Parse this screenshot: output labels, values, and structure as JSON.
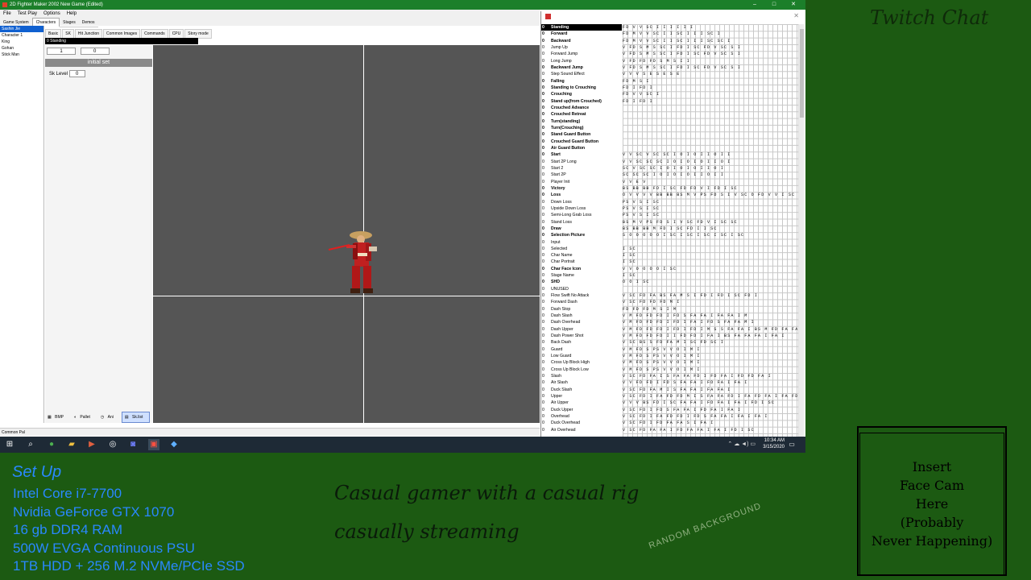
{
  "window": {
    "title": "2D Fighter Maker 2002 New Game (Edited)",
    "controls": [
      "–",
      "□",
      "✕"
    ]
  },
  "menu": [
    "File",
    "Test Play",
    "Options",
    "Help"
  ],
  "main_tabs": [
    "Game System",
    "Characters",
    "Stages",
    "Demos"
  ],
  "characters": [
    "Sashin Jie",
    "Character 1",
    "King",
    "Gohan",
    "Stick Man"
  ],
  "sub_tabs": [
    "Basic",
    "SK",
    "Hit Junction",
    "Common Images",
    "Commands",
    "CPU",
    "Story mode"
  ],
  "current_state_label": "0  Standing",
  "props": {
    "field1": "1",
    "field2": "0",
    "initial_set": "initial set",
    "sk_level_label": "Sk Level",
    "sk_level_value": "0"
  },
  "bottom_tools": [
    "BMP",
    "Pallet",
    "Ani",
    "Sk.list"
  ],
  "status": "Common Pal",
  "states": [
    {
      "n": "0",
      "label": "Standing",
      "bold": true,
      "sel": true,
      "cells": "FD V V SC I I I I I I"
    },
    {
      "n": "0",
      "label": "Forward",
      "bold": true,
      "cells": "FD M V V SC I I SC I I I SC I"
    },
    {
      "n": "0",
      "label": "Backward",
      "bold": true,
      "cells": "FD M V V SC I I SC I I I SC SC I"
    },
    {
      "n": "0",
      "label": "Jump Up",
      "bold": false,
      "cells": "V FD S M S SC I FD I SC FD V SC S I"
    },
    {
      "n": "0",
      "label": "Forward Jump",
      "bold": false,
      "cells": "V FD S M S SC I FD I SC FD V SC S I"
    },
    {
      "n": "0",
      "label": "Long Jump",
      "bold": false,
      "cells": "V FD FD FD S M S I I"
    },
    {
      "n": "0",
      "label": "Backward Jump",
      "bold": true,
      "cells": "V FD S M S SC I FD I SC FD V SC S I"
    },
    {
      "n": "0",
      "label": "Step Sound Effect",
      "bold": false,
      "cells": "V V V S E S E S E"
    },
    {
      "n": "0",
      "label": "Falling",
      "bold": true,
      "cells": "FD M S I"
    },
    {
      "n": "0",
      "label": "Standing to Crouching",
      "bold": true,
      "cells": "FD I FD I"
    },
    {
      "n": "0",
      "label": "Crouching",
      "bold": true,
      "cells": "FD V V SC I"
    },
    {
      "n": "0",
      "label": "Stand up(from Crouched)",
      "bold": true,
      "cells": "FD I FD I"
    },
    {
      "n": "0",
      "label": "Crouched Advance",
      "bold": true,
      "cells": ""
    },
    {
      "n": "0",
      "label": "Crouched Retreat",
      "bold": true,
      "cells": ""
    },
    {
      "n": "0",
      "label": "Turn(standing)",
      "bold": true,
      "cells": ""
    },
    {
      "n": "0",
      "label": "Turn(Crouching)",
      "bold": true,
      "cells": ""
    },
    {
      "n": "0",
      "label": "Stand Guard Button",
      "bold": true,
      "cells": ""
    },
    {
      "n": "0",
      "label": "Crouched Guard Button",
      "bold": true,
      "cells": ""
    },
    {
      "n": "0",
      "label": "Air Guard Button",
      "bold": true,
      "cells": ""
    },
    {
      "n": "0",
      "label": "Start",
      "bold": true,
      "cells": "V V SC V SC SC I O I O I I O I I"
    },
    {
      "n": "0",
      "label": "Start 2P Long",
      "bold": false,
      "cells": "V V SC SC SC I O I O I O I I O I"
    },
    {
      "n": "0",
      "label": "Start 2",
      "bold": false,
      "cells": "SC V SC SC I O I O I O I I O I"
    },
    {
      "n": "0",
      "label": "Start 2P",
      "bold": false,
      "cells": "SC SC SC I O I O I O I I O I I"
    },
    {
      "n": "0",
      "label": "Player Init",
      "bold": false,
      "cells": "V V E V"
    },
    {
      "n": "0",
      "label": "Victory",
      "bold": true,
      "cells": "BS BB BB FD I SC FD FD V I FD I SC"
    },
    {
      "n": "0",
      "label": "Loss",
      "bold": true,
      "cells": "O V V V V BB BB BS M V PS FD S I V SC O FD V V I SC SC"
    },
    {
      "n": "0",
      "label": "Down Loss",
      "bold": false,
      "cells": "PS V S I SC"
    },
    {
      "n": "0",
      "label": "Upside Down Loss",
      "bold": false,
      "cells": "PS V S I SC"
    },
    {
      "n": "0",
      "label": "Semi-Long Grab Loss",
      "bold": false,
      "cells": "PS V S I SC"
    },
    {
      "n": "0",
      "label": "Stand Loss",
      "bold": false,
      "cells": "BS M V PS FD S I V SC FD V I SC SC"
    },
    {
      "n": "0",
      "label": "Draw",
      "bold": true,
      "cells": "BS BB BB M FD I SC FD I I SC"
    },
    {
      "n": "0",
      "label": "Selection Picture",
      "bold": true,
      "cells": "S O O O O O I SC I SC I SC I SC I SC"
    },
    {
      "n": "0",
      "label": "Input",
      "bold": false,
      "cells": ""
    },
    {
      "n": "0",
      "label": "Selected",
      "bold": false,
      "cells": "I SC"
    },
    {
      "n": "0",
      "label": "Char Name",
      "bold": false,
      "cells": "I SC"
    },
    {
      "n": "0",
      "label": "Char Portrait",
      "bold": false,
      "cells": "I SC"
    },
    {
      "n": "0",
      "label": "Char Face Icon",
      "bold": true,
      "cells": "V V O O O O I SC"
    },
    {
      "n": "0",
      "label": "Stage Name",
      "bold": false,
      "cells": "I SC"
    },
    {
      "n": "0",
      "label": "SHD",
      "bold": true,
      "cells": "O O I SC"
    },
    {
      "n": "0",
      "label": "UNUSED",
      "bold": false,
      "cells": ""
    },
    {
      "n": "0",
      "label": "Flow Swift No Attack",
      "bold": false,
      "cells": "V SC FD FA BS FA M S I FD I FD I SC FD I"
    },
    {
      "n": "0",
      "label": "Forward Dash",
      "bold": false,
      "cells": "V SC FD FD FD M I"
    },
    {
      "n": "0",
      "label": "Dash Stop",
      "bold": false,
      "cells": "FD FD FD M S I M"
    },
    {
      "n": "0",
      "label": "Dash Slash",
      "bold": false,
      "cells": "V M FD FD FD I FD S FA FA I FA FA I M"
    },
    {
      "n": "0",
      "label": "Dash Overhead",
      "bold": false,
      "cells": "V M FD FD FD I FD I FA I FD S FA FA M I"
    },
    {
      "n": "0",
      "label": "Dash Upper",
      "bold": false,
      "cells": "V M FD FD FD I FD I FD I M S S FA FA I BS M FD FA FA I M FA BS I"
    },
    {
      "n": "0",
      "label": "Dash Power Shot",
      "bold": false,
      "cells": "V M FD FD FD I I FD FD I FA I BS FA FA FA I FA I"
    },
    {
      "n": "0",
      "label": "Back Dash",
      "bold": false,
      "cells": "V SC BS S FD FA M I SC FD SC I"
    },
    {
      "n": "0",
      "label": "Guard",
      "bold": false,
      "cells": "V M FD S PS V V O I M I"
    },
    {
      "n": "0",
      "label": "Low Guard",
      "bold": false,
      "cells": "V M FD S PS V V O I M I"
    },
    {
      "n": "0",
      "label": "Cross Up Block High",
      "bold": false,
      "cells": "V M FD S PS V V O I M I"
    },
    {
      "n": "0",
      "label": "Cross Up Block Low",
      "bold": false,
      "cells": "V M FD S PS V V O I M I"
    },
    {
      "n": "0",
      "label": "Slash",
      "bold": false,
      "cells": "V SC FD FA I S FA FA FD I FD FA I FD FD FA I"
    },
    {
      "n": "0",
      "label": "Air Slash",
      "bold": false,
      "cells": "V V FD FD I FD S FA FA I FD FA I FA I"
    },
    {
      "n": "0",
      "label": "Duck Slash",
      "bold": false,
      "cells": "V SC FD FA M I S FA FA I FA FA I"
    },
    {
      "n": "0",
      "label": "Upper",
      "bold": false,
      "cells": "V SC FD I FA FD FD M I S FA FA FD I FA FD FA I FA FD FA I FA I"
    },
    {
      "n": "0",
      "label": "Air Upper",
      "bold": false,
      "cells": "V V V BS FD I SC FA FA I FD FA I FA I FD I SC"
    },
    {
      "n": "0",
      "label": "Duck Upper",
      "bold": false,
      "cells": "V SC FD I FD S FA FA I FD FA I FA I"
    },
    {
      "n": "0",
      "label": "Overhead",
      "bold": false,
      "cells": "V SC FD I FA FD FD I FD S FA FA I FA I FA I"
    },
    {
      "n": "0",
      "label": "Duck Overhead",
      "bold": false,
      "cells": "V SC FD I FD FA FA S I FA I"
    },
    {
      "n": "0",
      "label": "Air Overhead",
      "bold": false,
      "cells": "V SC FD FA FA I FD FA FA I FA I FD I SC"
    }
  ],
  "taskbar": {
    "clock_time": "10:34 AM",
    "clock_date": "3/15/2020"
  },
  "overlay": {
    "twitch_chat": "Twitch Chat",
    "setup_title": "Set Up",
    "setup_specs": [
      "Intel Core i7-7700",
      "Nvidia GeForce GTX 1070",
      "16 gb DDR4 RAM",
      "500W EVGA Continuous PSU",
      "1TB HDD + 256 M.2 NVMe/PCIe SSD"
    ],
    "tagline1": "Casual gamer with a casual rig",
    "tagline2": "casually streaming",
    "random_background": "RANDOM BACKGROUND",
    "facecam_lines": [
      "Insert",
      "Face Cam",
      "Here",
      "(Probably",
      "Never Happening)"
    ]
  }
}
